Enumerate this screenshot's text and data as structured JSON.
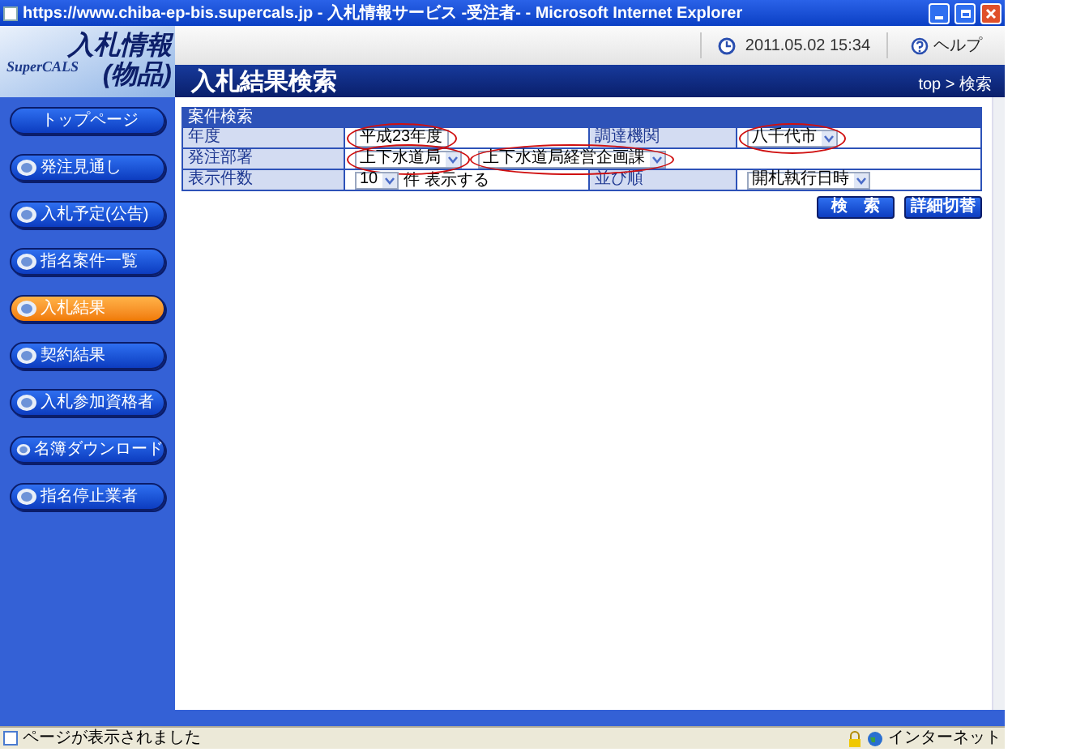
{
  "window": {
    "title": "https://www.chiba-ep-bis.supercals.jp - 入札情報サービス -受注者- - Microsoft Internet Explorer"
  },
  "header": {
    "brand": "SuperCALS",
    "title": "入札情報",
    "subtitle": "(物品)",
    "datetime": "2011.05.02 15:34",
    "help": "ヘルプ",
    "page_title": "入札結果検索",
    "breadcrumb": "top > 検索"
  },
  "sidebar": {
    "items": [
      {
        "label": "トップページ",
        "kind": "plain",
        "selected": false
      },
      {
        "label": "発注見通し",
        "kind": "icon",
        "selected": false
      },
      {
        "label": "入札予定(公告)",
        "kind": "icon",
        "selected": false
      },
      {
        "label": "指名案件一覧",
        "kind": "icon",
        "selected": false
      },
      {
        "label": "入札結果",
        "kind": "icon",
        "selected": true
      },
      {
        "label": "契約結果",
        "kind": "icon",
        "selected": false
      },
      {
        "label": "入札参加資格者",
        "kind": "icon",
        "selected": false
      },
      {
        "label": "名簿ダウンロード",
        "kind": "icon",
        "selected": false
      },
      {
        "label": "指名停止業者",
        "kind": "icon",
        "selected": false
      }
    ]
  },
  "search_form": {
    "title": "案件検索",
    "rows": [
      {
        "label": "年度",
        "fields": [
          {
            "value": "平成23年度",
            "dropdown": false,
            "circled": true
          }
        ],
        "label_2": "調達機関",
        "fields_2": [
          {
            "value": "八千代市",
            "dropdown": true,
            "circled": true
          }
        ]
      },
      {
        "label": "発注部署",
        "fields": [
          {
            "value": "上下水道局",
            "dropdown": true,
            "circled": true
          },
          {
            "value": "上下水道局経営企画課",
            "dropdown": true,
            "circled": true
          }
        ]
      },
      {
        "label": "表示件数",
        "fields": [
          {
            "value": "10",
            "dropdown": true,
            "circled": false
          }
        ],
        "suffix": "件 表示する",
        "label_2": "並び順",
        "fields_2": [
          {
            "value": "開札執行日時",
            "dropdown": true,
            "circled": false
          }
        ]
      }
    ],
    "buttons": [
      "検　索",
      "詳細切替"
    ]
  },
  "status_bar": {
    "text": "ページが表示されました",
    "zone": "インターネット"
  }
}
